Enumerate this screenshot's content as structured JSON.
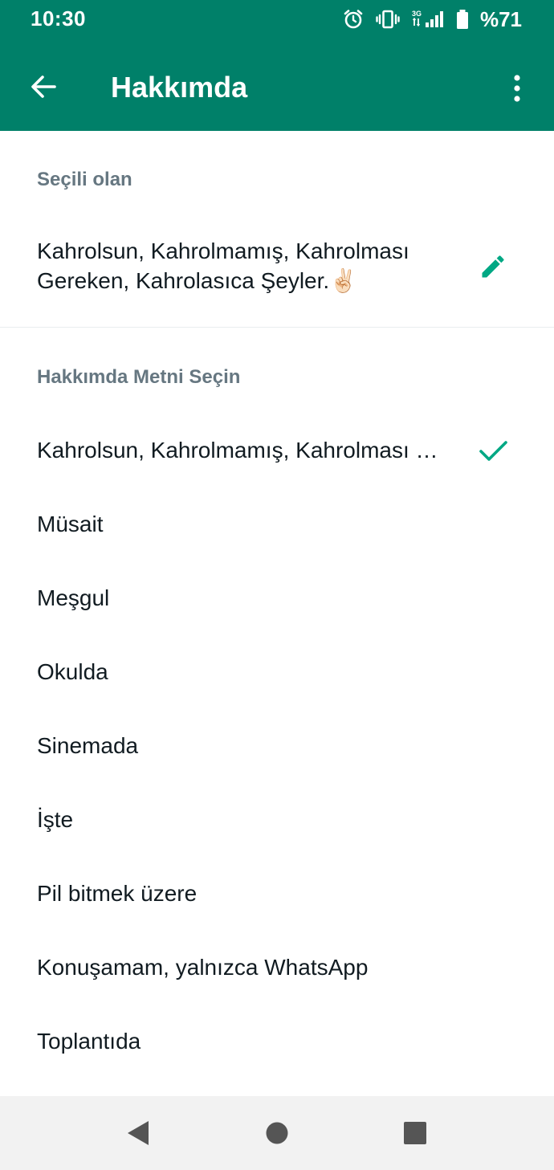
{
  "status_bar": {
    "time": "10:30",
    "battery": "%71",
    "network": "3G",
    "icons": [
      "alarm-icon",
      "vibrate-icon",
      "signal-icon",
      "battery-icon"
    ]
  },
  "toolbar": {
    "title": "Hakkımda",
    "back_icon": "back-arrow-icon",
    "menu_icon": "more-vert-icon",
    "background": "#008069"
  },
  "current": {
    "header": "Seçili olan",
    "text": "Kahrolsun, Kahrolmamış, Kahrolması Gereken, Kahrolasıca Şeyler.✌🏻",
    "edit_icon": "pencil-icon",
    "accent": "#00a884"
  },
  "options": {
    "header": "Hakkımda Metni Seçin",
    "items": [
      {
        "label": "Kahrolsun, Kahrolmamış, Kahrolması Gereken, Kahrolasıca Şeyler.✌🏻",
        "selected": true
      },
      {
        "label": "Müsait",
        "selected": false
      },
      {
        "label": "Meşgul",
        "selected": false
      },
      {
        "label": "Okulda",
        "selected": false
      },
      {
        "label": "Sinemada",
        "selected": false
      },
      {
        "label": "İşte",
        "selected": false
      },
      {
        "label": "Pil bitmek üzere",
        "selected": false
      },
      {
        "label": "Konuşamam, yalnızca WhatsApp",
        "selected": false
      },
      {
        "label": "Toplantıda",
        "selected": false
      }
    ]
  },
  "nav_bar": {
    "icons": [
      "nav-back-icon",
      "nav-home-icon",
      "nav-recents-icon"
    ]
  }
}
